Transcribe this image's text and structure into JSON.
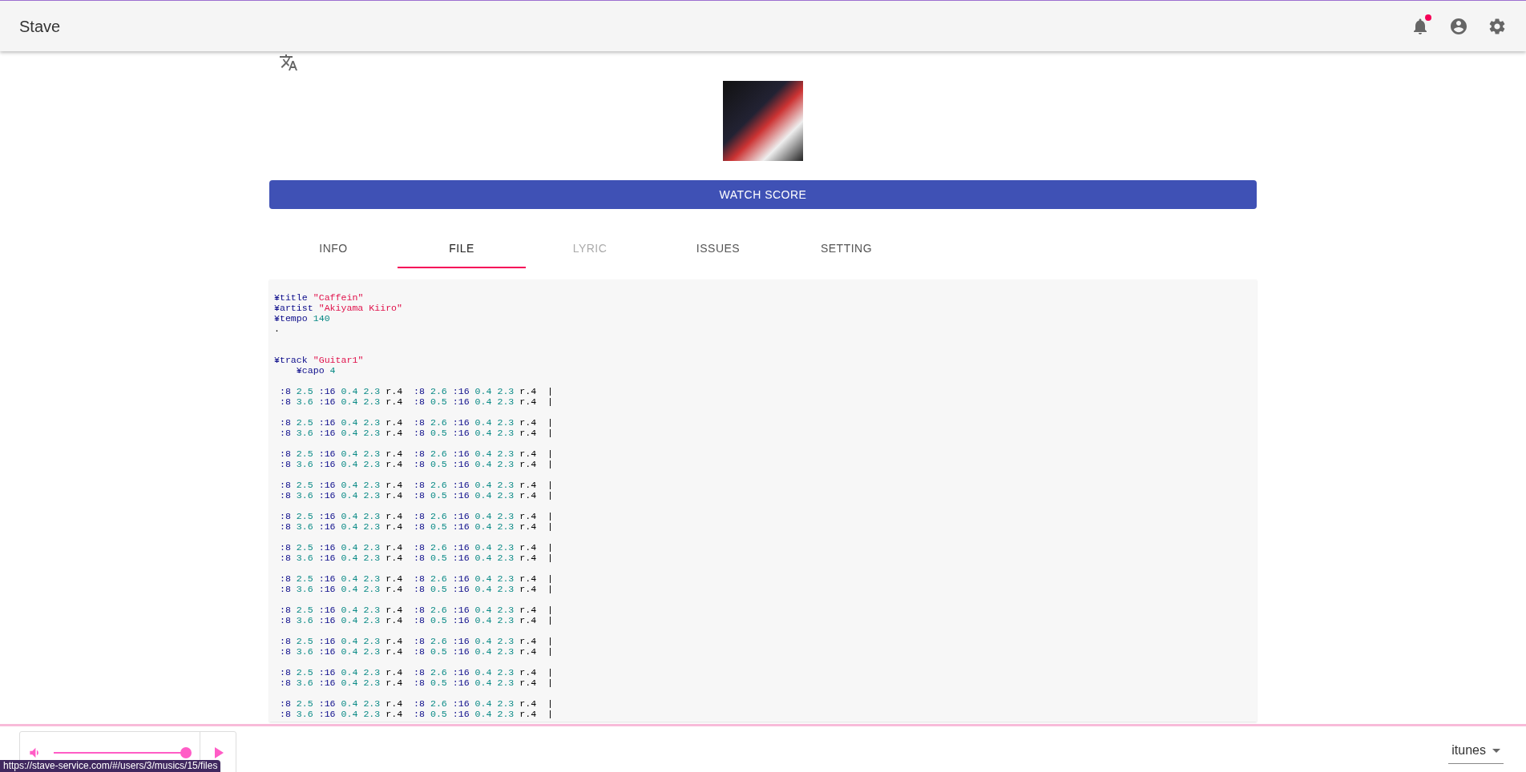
{
  "app_bar": {
    "title": "Stave",
    "notification_unread": true
  },
  "cover": {
    "kind": "photo"
  },
  "watch_button": "WATCH SCORE",
  "tabs": [
    {
      "label": "INFO",
      "selected": false,
      "disabled": false
    },
    {
      "label": "FILE",
      "selected": true,
      "disabled": false
    },
    {
      "label": "LYRIC",
      "selected": false,
      "disabled": true
    },
    {
      "label": "ISSUES",
      "selected": false,
      "disabled": false
    },
    {
      "label": "SETTING",
      "selected": false,
      "disabled": false
    }
  ],
  "code": {
    "header_lines": [
      "¥title \"Caffein\"",
      "¥artist \"Akiyama Kiiro\"",
      "¥tempo 140",
      "."
    ],
    "track_lines": [
      "¥track \"Guitar1\"",
      "    ¥capo 4"
    ],
    "measures": [
      [
        " :8 2.5 :16 0.4 2.3 r.4  :8 2.6 :16 0.4 2.3 r.4  |",
        " :8 3.6 :16 0.4 2.3 r.4  :8 0.5 :16 0.4 2.3 r.4  |"
      ],
      [
        " :8 2.5 :16 0.4 2.3 r.4  :8 2.6 :16 0.4 2.3 r.4  |",
        " :8 3.6 :16 0.4 2.3 r.4  :8 0.5 :16 0.4 2.3 r.4  |"
      ],
      [
        " :8 2.5 :16 0.4 2.3 r.4  :8 2.6 :16 0.4 2.3 r.4  |",
        " :8 3.6 :16 0.4 2.3 r.4  :8 0.5 :16 0.4 2.3 r.4  |"
      ],
      [
        " :8 2.5 :16 0.4 2.3 r.4  :8 2.6 :16 0.4 2.3 r.4  |",
        " :8 3.6 :16 0.4 2.3 r.4  :8 0.5 :16 0.4 2.3 r.4  |"
      ],
      [
        " :8 2.5 :16 0.4 2.3 r.4  :8 2.6 :16 0.4 2.3 r.4  |",
        " :8 3.6 :16 0.4 2.3 r.4  :8 0.5 :16 0.4 2.3 r.4  |"
      ],
      [
        " :8 2.5 :16 0.4 2.3 r.4  :8 2.6 :16 0.4 2.3 r.4  |",
        " :8 3.6 :16 0.4 2.3 r.4  :8 0.5 :16 0.4 2.3 r.4  |"
      ],
      [
        " :8 2.5 :16 0.4 2.3 r.4  :8 2.6 :16 0.4 2.3 r.4  |",
        " :8 3.6 :16 0.4 2.3 r.4  :8 0.5 :16 0.4 2.3 r.4  |"
      ],
      [
        " :8 2.5 :16 0.4 2.3 r.4  :8 2.6 :16 0.4 2.3 r.4  |",
        " :8 3.6 :16 0.4 2.3 r.4  :8 0.5 :16 0.4 2.3 r.4  |"
      ],
      [
        " :8 2.5 :16 0.4 2.3 r.4  :8 2.6 :16 0.4 2.3 r.4  |",
        " :8 3.6 :16 0.4 2.3 r.4  :8 0.5 :16 0.4 2.3 r.4  |"
      ],
      [
        " :8 2.5 :16 0.4 2.3 r.4  :8 2.6 :16 0.4 2.3 r.4  |",
        " :8 3.6 :16 0.4 2.3 r.4  :8 0.5 :16 0.4 2.3 r.4  |"
      ],
      [
        " :8 2.5 :16 0.4 2.3 r.4  :8 2.6 :16 0.4 2.3 r.4  |",
        " :8 3.6 :16 0.4 2.3 r.4  :8 0.5 :16 0.4 2.3 r.4  |"
      ]
    ]
  },
  "player": {
    "volume": {
      "level": 1.0
    },
    "source": "itunes"
  },
  "status_url": "https://stave-service.com/#/users/3/musics/15/files"
}
